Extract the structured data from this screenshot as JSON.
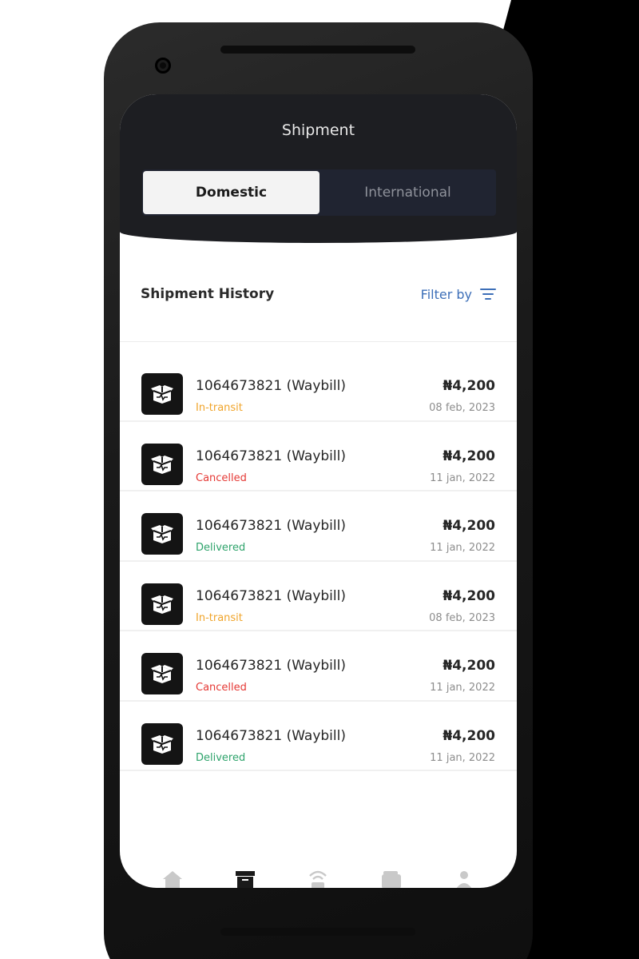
{
  "header": {
    "title": "Shipment"
  },
  "tabs": [
    {
      "label": "Domestic",
      "active": true
    },
    {
      "label": "International",
      "active": false
    }
  ],
  "history": {
    "title": "Shipment History",
    "filter_label": "Filter by"
  },
  "status_colors": {
    "In-transit": "#f0a42a",
    "Cancelled": "#e53935",
    "Delivered": "#2ea36b"
  },
  "shipments": [
    {
      "title": "1064673821 (Waybill)",
      "status": "In-transit",
      "amount": "₦4,200",
      "date": "08 feb, 2023"
    },
    {
      "title": "1064673821 (Waybill)",
      "status": "Cancelled",
      "amount": "₦4,200",
      "date": "11 jan, 2022"
    },
    {
      "title": "1064673821 (Waybill)",
      "status": "Delivered",
      "amount": "₦4,200",
      "date": "11 jan, 2022"
    },
    {
      "title": "1064673821 (Waybill)",
      "status": "In-transit",
      "amount": "₦4,200",
      "date": "08 feb, 2023"
    },
    {
      "title": "1064673821 (Waybill)",
      "status": "Cancelled",
      "amount": "₦4,200",
      "date": "11 jan, 2022"
    },
    {
      "title": "1064673821 (Waybill)",
      "status": "Delivered",
      "amount": "₦4,200",
      "date": "11 jan, 2022"
    }
  ],
  "bottom_nav": [
    {
      "icon": "home-icon"
    },
    {
      "icon": "archive-box-icon"
    },
    {
      "icon": "signal-tower-icon"
    },
    {
      "icon": "wallet-icon"
    },
    {
      "icon": "profile-icon"
    }
  ]
}
